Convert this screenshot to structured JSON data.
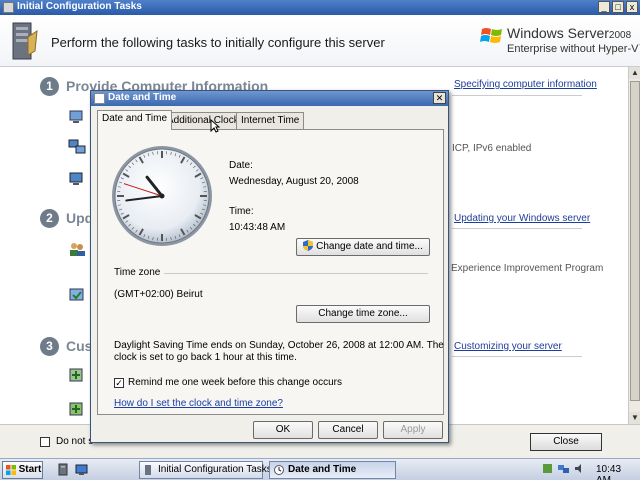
{
  "main_window": {
    "title": "Initial Configuration Tasks",
    "header_task": "Perform the following tasks to initially configure this server",
    "logo": {
      "brand": "Windows Server",
      "year": "2008",
      "edition": "Enterprise without Hyper-V™"
    },
    "steps": [
      {
        "number": "1",
        "title": "Provide Computer Information",
        "link": "Specifying computer information"
      },
      {
        "number": "2",
        "title": "Upd",
        "link": "Updating your Windows server"
      },
      {
        "number": "3",
        "title": "Cus",
        "link": "Customizing your server"
      }
    ],
    "side_texts": {
      "ipv6": "ICP, IPv6 enabled",
      "ceip": "Experience Improvement Program"
    },
    "footer": {
      "dont_show_label": "Do not s",
      "close_label": "Close"
    }
  },
  "dialog": {
    "title": "Date and Time",
    "close_glyph": "✕",
    "tabs": [
      "Date and Time",
      "Additional Clocks",
      "Internet Time"
    ],
    "date_label": "Date:",
    "date_value": "Wednesday, August 20, 2008",
    "time_label": "Time:",
    "time_value": "10:43:48 AM",
    "change_date_label": "Change date and time...",
    "tz_label": "Time zone",
    "tz_value": "(GMT+02:00) Beirut",
    "change_tz_label": "Change time zone...",
    "dst_line1": "Daylight Saving Time ends on Sunday, October 26, 2008 at 12:00 AM. The",
    "dst_line2": "clock is set to go back 1 hour at this time.",
    "remind_checked": true,
    "remind_label": "Remind me one week before this change occurs",
    "help_link": "How do I set the clock and time zone?",
    "ok_label": "OK",
    "cancel_label": "Cancel",
    "apply_label": "Apply"
  },
  "taskbar": {
    "start_label": "Start",
    "tasks": [
      "Initial Configuration Tasks",
      "Date and Time"
    ],
    "clock": "10:43 AM"
  },
  "colors": {
    "titlebar": "#3a68b0",
    "link": "#1a3ea8",
    "step_badge": "#6e7b8b"
  }
}
